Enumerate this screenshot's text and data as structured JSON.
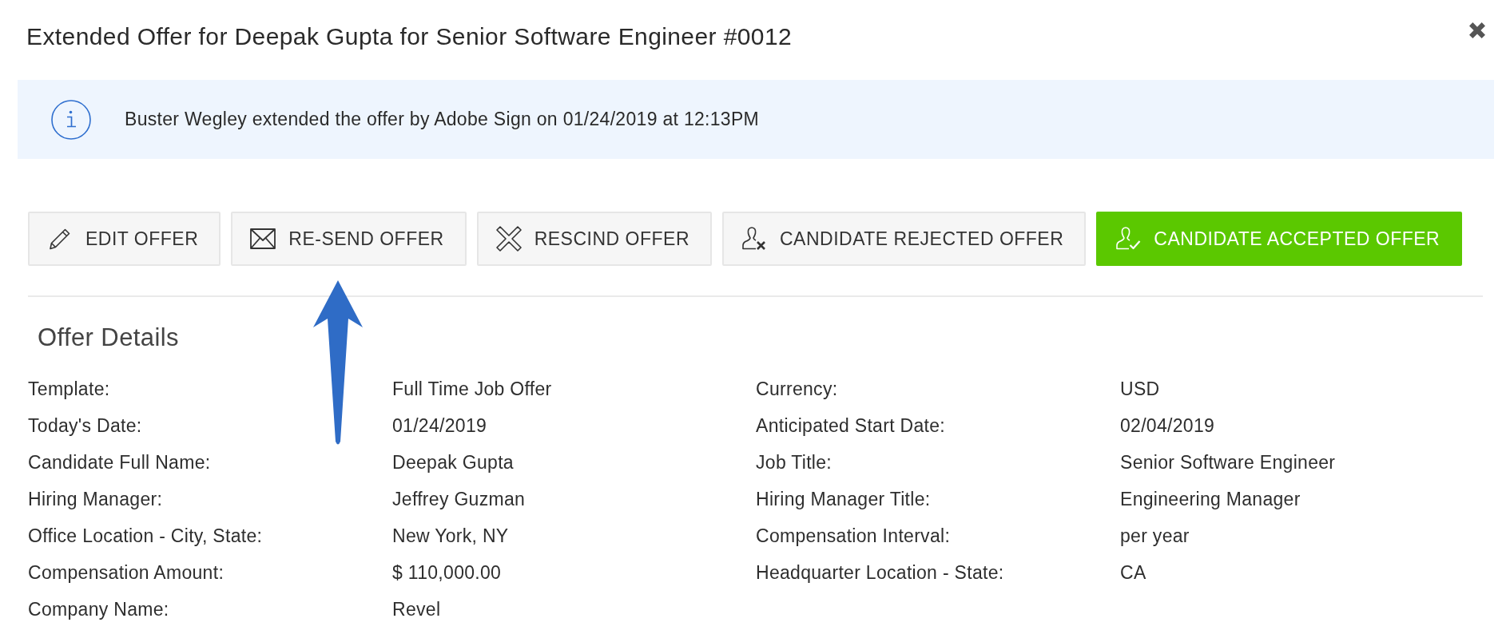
{
  "dialog": {
    "title": "Extended Offer for Deepak Gupta for Senior Software Engineer #0012"
  },
  "notice": {
    "text": "Buster Wegley extended the offer by Adobe Sign on 01/24/2019 at 12:13PM"
  },
  "actions": [
    {
      "kind": "edit",
      "label": "EDIT OFFER",
      "primary": false
    },
    {
      "kind": "resend",
      "label": "RE-SEND OFFER",
      "primary": false
    },
    {
      "kind": "rescind",
      "label": "RESCIND OFFER",
      "primary": false
    },
    {
      "kind": "reject",
      "label": "CANDIDATE REJECTED OFFER",
      "primary": false
    },
    {
      "kind": "accept",
      "label": "CANDIDATE ACCEPTED OFFER",
      "primary": true
    }
  ],
  "offer_details": {
    "heading": "Offer Details",
    "columns": [
      {
        "fields": [
          {
            "label": "Template:",
            "value": "Full Time Job Offer"
          },
          {
            "label": "Today's Date:",
            "value": "01/24/2019"
          },
          {
            "label": "Candidate Full Name:",
            "value": "Deepak Gupta"
          },
          {
            "label": "Hiring Manager:",
            "value": "Jeffrey Guzman"
          },
          {
            "label": "Office Location - City, State:",
            "value": "New York, NY"
          },
          {
            "label": "Compensation Amount:",
            "value": "$ 110,000.00"
          },
          {
            "label": "Company Name:",
            "value": "Revel"
          }
        ]
      },
      {
        "fields": [
          {
            "label": "Currency:",
            "value": "USD"
          },
          {
            "label": "Anticipated Start Date:",
            "value": "02/04/2019"
          },
          {
            "label": "Job Title:",
            "value": "Senior Software Engineer"
          },
          {
            "label": "Hiring Manager Title:",
            "value": "Engineering Manager"
          },
          {
            "label": "Compensation Interval:",
            "value": "per year"
          },
          {
            "label": "Headquarter Location - State:",
            "value": "CA"
          }
        ]
      }
    ]
  }
}
